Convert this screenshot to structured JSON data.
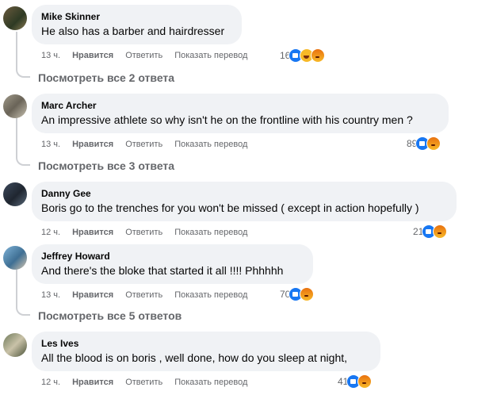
{
  "comments": [
    {
      "author": "Mike Skinner",
      "text": "He also has a barber and hairdresser",
      "time": "13 ч.",
      "like": "Нравится",
      "reply": "Ответить",
      "translate": "Показать перевод",
      "reaction_count": "16",
      "reactions": [
        "like-icon",
        "haha-icon",
        "angry-icon"
      ],
      "view_replies": "Посмотреть все 2 ответа"
    },
    {
      "author": "Marc Archer",
      "text": "An impressive athlete so why isn't he on the frontline with his country men ?",
      "time": "13 ч.",
      "like": "Нравится",
      "reply": "Ответить",
      "translate": "Показать перевод",
      "reaction_count": "89",
      "reactions": [
        "like-icon",
        "angry-icon"
      ],
      "view_replies": "Посмотреть все 3 ответа"
    },
    {
      "author": "Danny Gee",
      "text": "Boris go to the trenches for you won't be missed ( except in action hopefully )",
      "time": "12 ч.",
      "like": "Нравится",
      "reply": "Ответить",
      "translate": "Показать перевод",
      "reaction_count": "21",
      "reactions": [
        "like-icon",
        "angry-icon"
      ]
    },
    {
      "author": "Jeffrey Howard",
      "text": "And there's the bloke that started it all !!!! Phhhhh",
      "time": "13 ч.",
      "like": "Нравится",
      "reply": "Ответить",
      "translate": "Показать перевод",
      "reaction_count": "70",
      "reactions": [
        "like-icon",
        "angry-icon"
      ],
      "view_replies": "Посмотреть все 5 ответов"
    },
    {
      "author": "Les Ives",
      "text": "All the blood is on boris , well done, how do you sleep at night,",
      "time": "12 ч.",
      "like": "Нравится",
      "reply": "Ответить",
      "translate": "Показать перевод",
      "reaction_count": "41",
      "reactions": [
        "like-icon",
        "angry-icon"
      ]
    }
  ],
  "colors": {
    "bubble": "#f0f2f5",
    "secondary_text": "#65676b",
    "like_blue": "#1877f2"
  }
}
